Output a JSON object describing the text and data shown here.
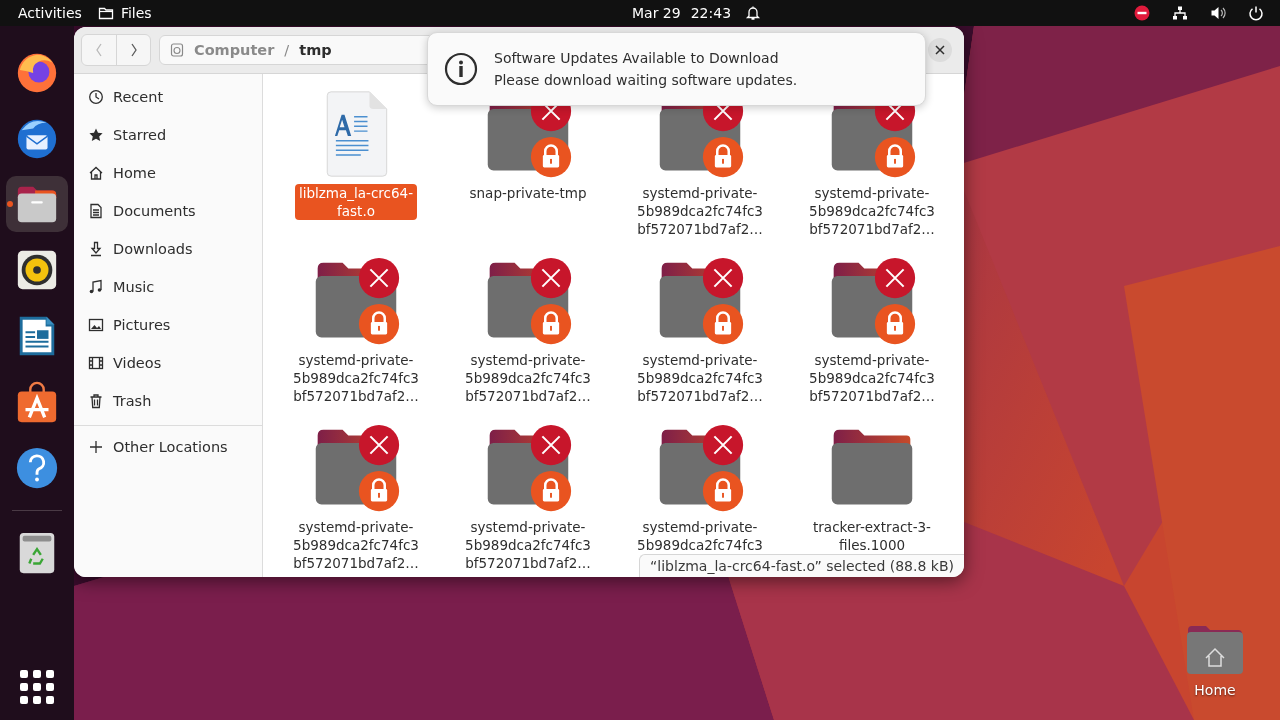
{
  "top_bar": {
    "activities": "Activities",
    "app_name": "Files",
    "date": "Mar 29",
    "time": "22:43"
  },
  "dock": {
    "apps": [
      {
        "kind": "firefox",
        "selected": false,
        "running": false
      },
      {
        "kind": "thunderbird",
        "selected": false,
        "running": false
      },
      {
        "kind": "files",
        "selected": true,
        "running": true
      },
      {
        "kind": "rhythmbox",
        "selected": false,
        "running": false
      },
      {
        "kind": "writer",
        "selected": false,
        "running": false
      },
      {
        "kind": "app-center",
        "selected": false,
        "running": false
      },
      {
        "kind": "help",
        "selected": false,
        "running": false
      }
    ],
    "extras": [
      {
        "kind": "trash",
        "selected": false,
        "running": false
      }
    ]
  },
  "window": {
    "nav": [
      {
        "kind": "back",
        "disabled": true
      },
      {
        "kind": "forward",
        "disabled": false
      }
    ],
    "path": [
      {
        "label": "Computer",
        "selected": false
      },
      {
        "label": "tmp",
        "selected": true
      }
    ],
    "path_separator": "/",
    "sidebar": {
      "items": [
        {
          "kind": "clock",
          "label": "Recent",
          "selected": false
        },
        {
          "kind": "star",
          "label": "Starred",
          "selected": false
        },
        {
          "kind": "home",
          "label": "Home",
          "selected": false
        },
        {
          "kind": "document",
          "label": "Documents",
          "selected": false
        },
        {
          "kind": "download",
          "label": "Downloads",
          "selected": false
        },
        {
          "kind": "music",
          "label": "Music",
          "selected": false
        },
        {
          "kind": "picture",
          "label": "Pictures",
          "selected": false
        },
        {
          "kind": "film",
          "label": "Videos",
          "selected": false
        },
        {
          "kind": "trash",
          "label": "Trash",
          "selected": false
        }
      ],
      "other": [
        {
          "kind": "plus",
          "label": "Other Locations",
          "selected": false
        }
      ]
    },
    "files": [
      {
        "kind": "file",
        "lines": [
          "liblzma_la-crc64-",
          "fast.o"
        ],
        "selected": true
      },
      {
        "kind": "locked-folder",
        "lines": [
          "snap-private-tmp"
        ],
        "selected": false
      },
      {
        "kind": "locked-folder",
        "lines": [
          "systemd-private-",
          "5b989dca2fc74fc3",
          "bf572071bd7af2…"
        ],
        "selected": false
      },
      {
        "kind": "locked-folder",
        "lines": [
          "systemd-private-",
          "5b989dca2fc74fc3",
          "bf572071bd7af2…"
        ],
        "selected": false
      },
      {
        "kind": "locked-folder",
        "lines": [
          "systemd-private-",
          "5b989dca2fc74fc3",
          "bf572071bd7af2…"
        ],
        "selected": false
      },
      {
        "kind": "locked-folder",
        "lines": [
          "systemd-private-",
          "5b989dca2fc74fc3",
          "bf572071bd7af2…"
        ],
        "selected": false
      },
      {
        "kind": "locked-folder",
        "lines": [
          "systemd-private-",
          "5b989dca2fc74fc3",
          "bf572071bd7af2…"
        ],
        "selected": false
      },
      {
        "kind": "locked-folder",
        "lines": [
          "systemd-private-",
          "5b989dca2fc74fc3",
          "bf572071bd7af2…"
        ],
        "selected": false
      },
      {
        "kind": "locked-folder",
        "lines": [
          "systemd-private-",
          "5b989dca2fc74fc3",
          "bf572071bd7af2…"
        ],
        "selected": false
      },
      {
        "kind": "locked-folder",
        "lines": [
          "systemd-private-",
          "5b989dca2fc74fc3",
          "bf572071bd7af2…"
        ],
        "selected": false
      },
      {
        "kind": "locked-folder",
        "lines": [
          "systemd-private-",
          "5b989dca2fc74fc3"
        ],
        "selected": false
      },
      {
        "kind": "folder",
        "lines": [
          "tracker-extract-3-",
          "files.1000"
        ],
        "selected": false
      }
    ],
    "status_bar": "“liblzma_la-crc64-fast.o” selected (88.8 kB)"
  },
  "notification": {
    "title": "Software Updates Available to Download",
    "body": "Please download waiting software updates."
  },
  "desktop": {
    "icons": [
      {
        "kind": "home-folder",
        "label": "Home"
      }
    ]
  }
}
